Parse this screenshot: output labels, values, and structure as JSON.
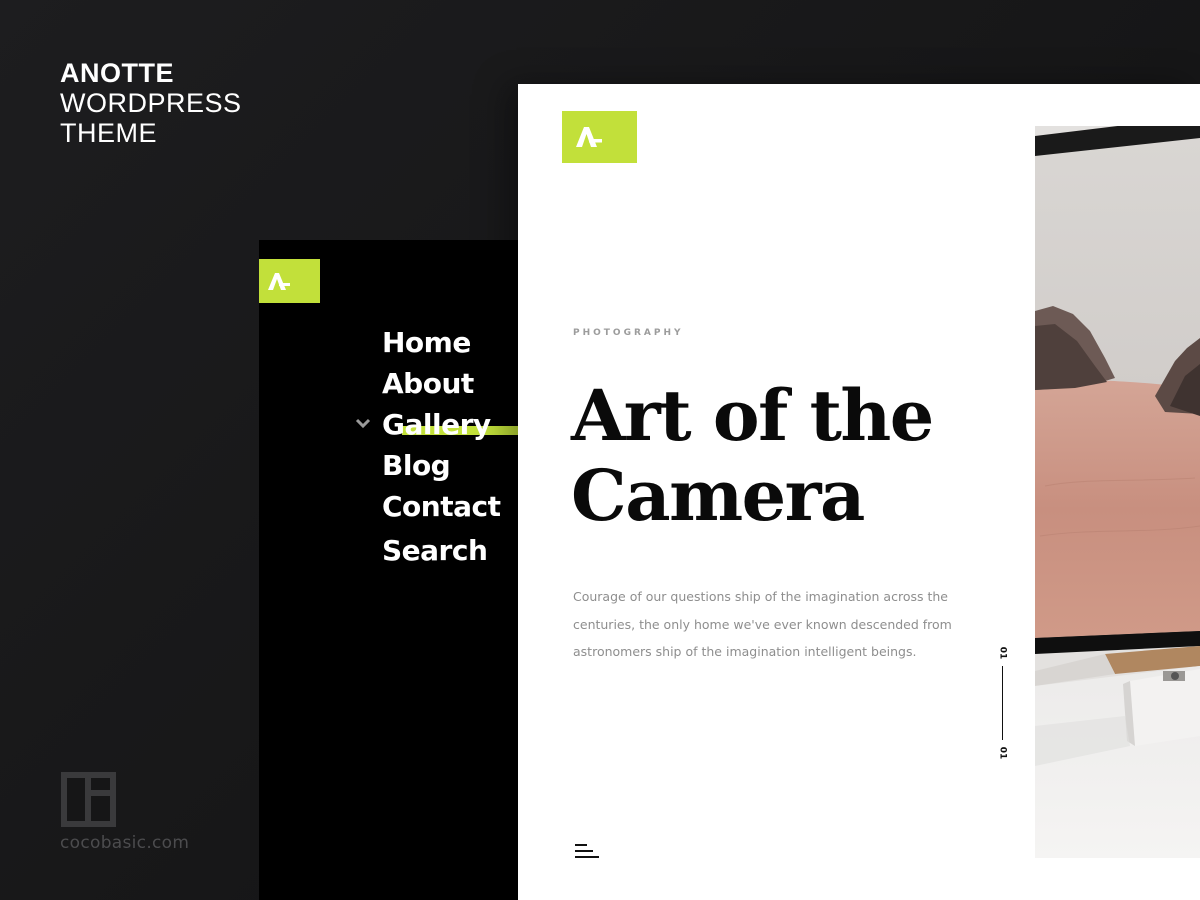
{
  "brand": {
    "name": "ANOTTE",
    "line2": "WORDPRESS",
    "line3": "THEME"
  },
  "footer": {
    "site_url": "cocobasic.com",
    "logo_icon": "cocobasic-logo-icon"
  },
  "menu": {
    "logo_icon": "anotte-a-logo-icon",
    "items": [
      {
        "label": "Home"
      },
      {
        "label": "About"
      },
      {
        "label": "Gallery",
        "active": true
      },
      {
        "label": "Blog"
      },
      {
        "label": "Contact"
      },
      {
        "label": "Search"
      }
    ]
  },
  "hero": {
    "logo_icon": "anotte-a-logo-icon",
    "category": "PHOTOGRAPHY",
    "title_line1": "Art of the",
    "title_line2": "Camera",
    "description": "Courage of our questions ship of the imagination across the centuries, the only home we've ever known descended from astronomers ship of the imagination intelligent beings.",
    "slide_current": "01",
    "slide_total": "01"
  },
  "colors": {
    "accent": "#c2e03a",
    "dark_bg": "#1a1a1b",
    "menu_bg": "#000000",
    "panel_bg": "#ffffff"
  }
}
